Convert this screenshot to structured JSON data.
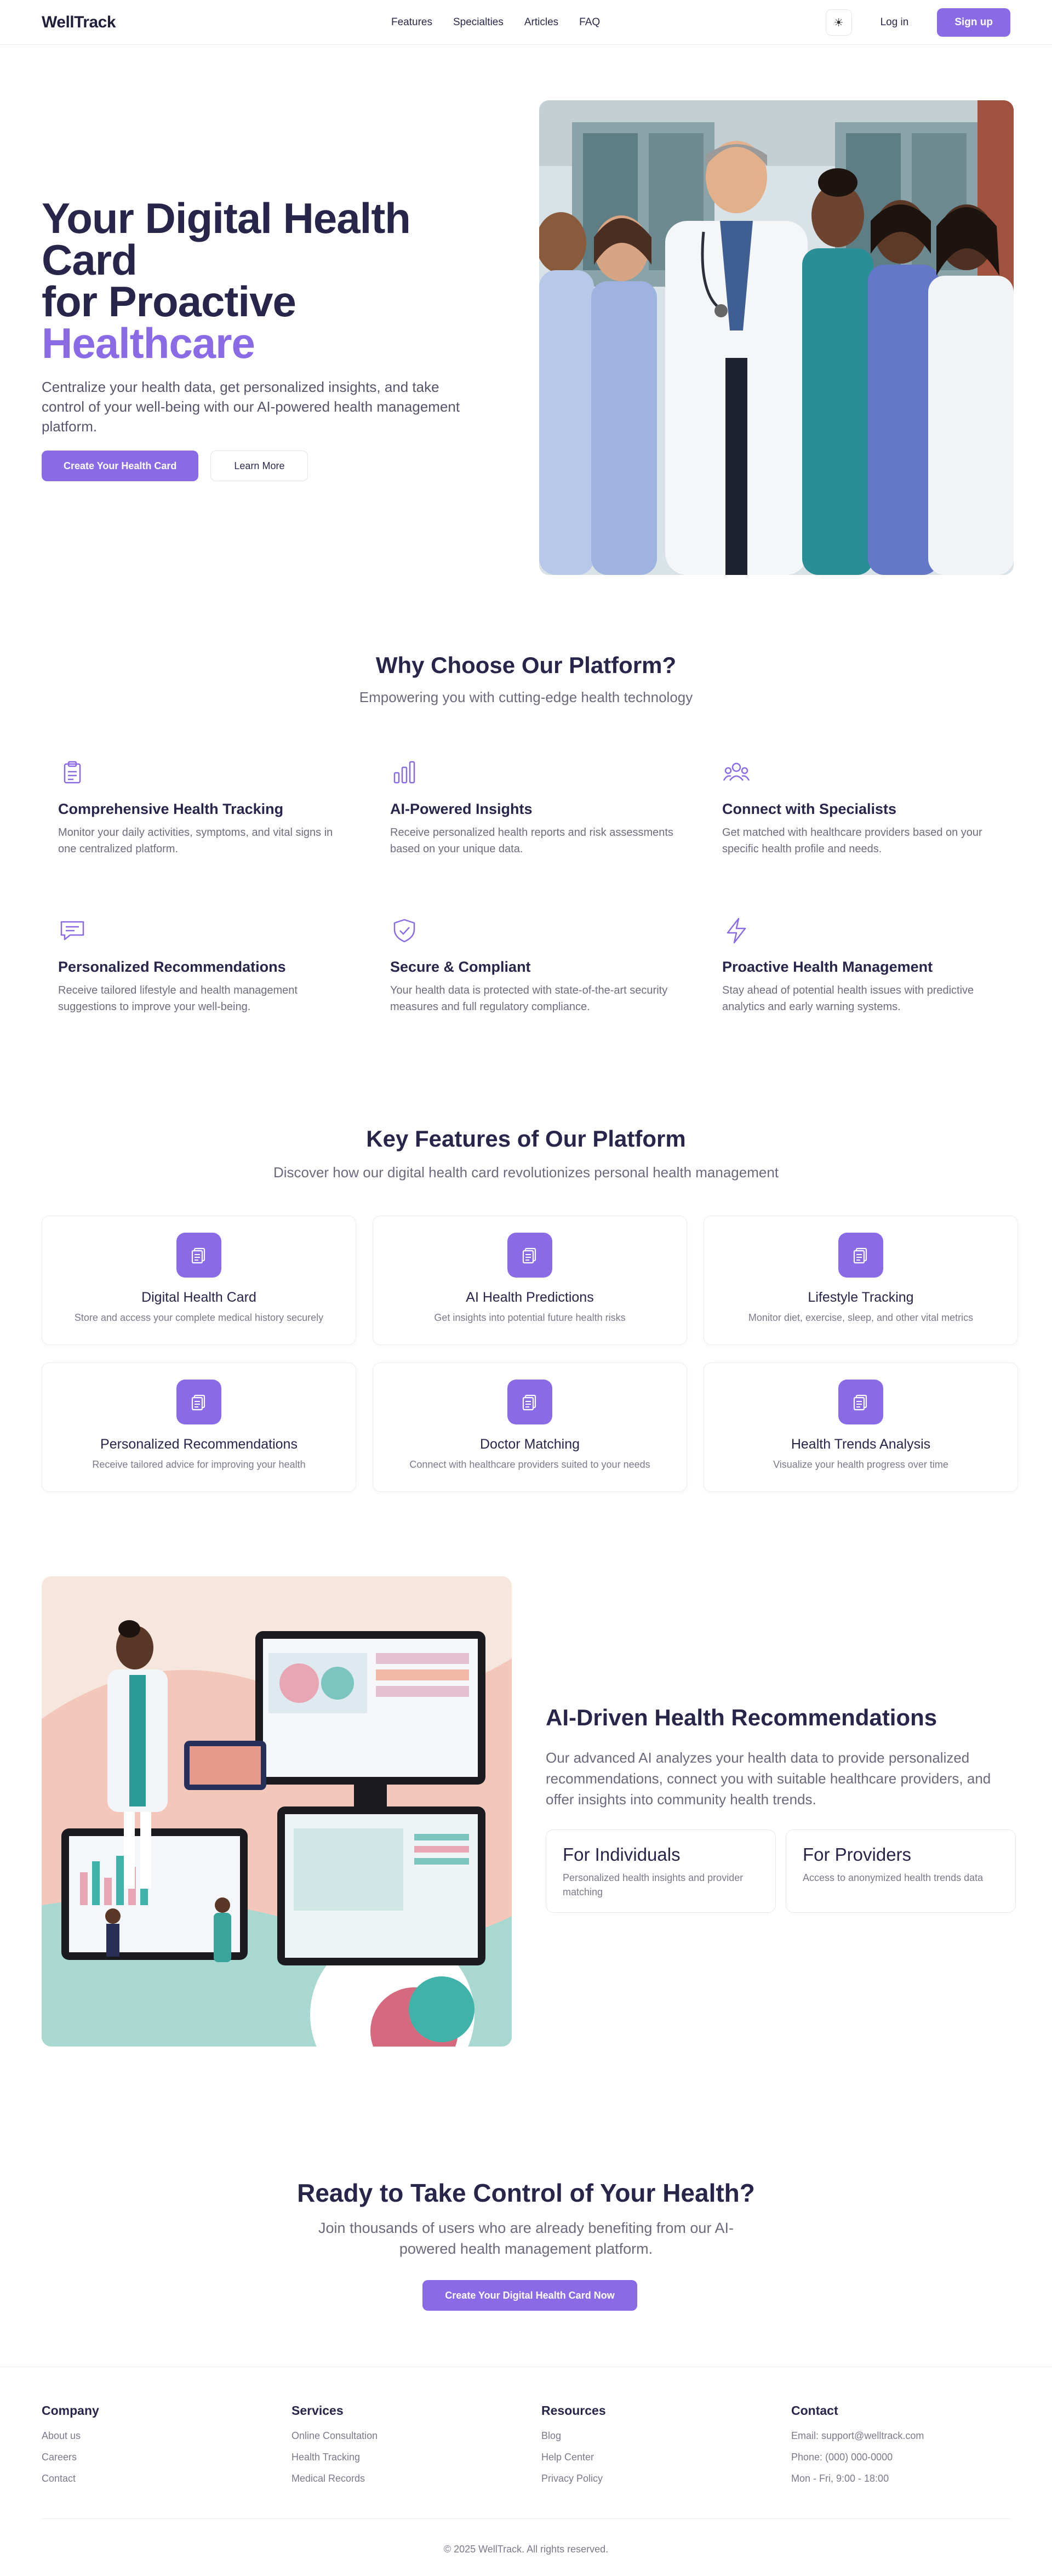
{
  "nav": {
    "logo": "WellTrack",
    "links": [
      "Features",
      "Specialties",
      "Articles",
      "FAQ"
    ],
    "theme_icon": "sun-icon",
    "theme_glyph": "☀",
    "login": "Log in",
    "signup": "Sign up"
  },
  "hero": {
    "title_line1": "Your Digital Health",
    "title_line2": "Card",
    "title_line3": "for Proactive",
    "title_accent": "Healthcare",
    "subtitle": "Centralize your health data, get personalized insights, and take control of your well-being with our AI-powered health management platform.",
    "primary_button": "Create Your Health Card",
    "secondary_button": "Learn More"
  },
  "why": {
    "title": "Why Choose Our Platform?",
    "subtitle": "Empowering you with cutting-edge health technology",
    "items": [
      {
        "icon": "clipboard-icon",
        "title": "Comprehensive Health Tracking",
        "desc": "Monitor your daily activities, symptoms, and vital signs in one centralized platform."
      },
      {
        "icon": "bar-chart-icon",
        "title": "AI-Powered Insights",
        "desc": "Receive personalized health reports and risk assessments based on your unique data."
      },
      {
        "icon": "users-icon",
        "title": "Connect with Specialists",
        "desc": "Get matched with healthcare providers based on your specific health profile and needs."
      },
      {
        "icon": "message-icon",
        "title": "Personalized Recommendations",
        "desc": "Receive tailored lifestyle and health management suggestions to improve your well-being."
      },
      {
        "icon": "shield-check-icon",
        "title": "Secure & Compliant",
        "desc": "Your health data is protected with state-of-the-art security measures and full regulatory compliance."
      },
      {
        "icon": "lightning-icon",
        "title": "Proactive Health Management",
        "desc": "Stay ahead of potential health issues with predictive analytics and early warning systems."
      }
    ]
  },
  "features": {
    "title": "Key Features of Our Platform",
    "subtitle": "Discover how our digital health card revolutionizes personal health management",
    "icon": "document-copy-icon",
    "cards": [
      {
        "title": "Digital Health Card",
        "desc": "Store and access your complete medical history securely"
      },
      {
        "title": "AI Health Predictions",
        "desc": "Get insights into potential future health risks"
      },
      {
        "title": "Lifestyle Tracking",
        "desc": "Monitor diet, exercise, sleep, and other vital metrics"
      },
      {
        "title": "Personalized Recommendations",
        "desc": "Receive tailored advice for improving your health"
      },
      {
        "title": "Doctor Matching",
        "desc": "Connect with healthcare providers suited to your needs"
      },
      {
        "title": "Health Trends Analysis",
        "desc": "Visualize your health progress over time"
      }
    ]
  },
  "ai": {
    "title": "AI-Driven Health Recommendations",
    "desc": "Our advanced AI analyzes your health data to provide personalized recommendations, connect you with suitable healthcare providers, and offer insights into community health trends.",
    "cards": [
      {
        "title": "For Individuals",
        "desc": "Personalized health insights and provider matching"
      },
      {
        "title": "For Providers",
        "desc": "Access to anonymized health trends data"
      }
    ]
  },
  "cta": {
    "title": "Ready to Take Control of Your Health?",
    "subtitle": "Join thousands of users who are already benefiting from our AI-powered health management platform.",
    "button": "Create Your Digital Health Card Now"
  },
  "footer": {
    "columns": [
      {
        "heading": "Company",
        "links": [
          "About us",
          "Careers",
          "Contact"
        ]
      },
      {
        "heading": "Services",
        "links": [
          "Online Consultation",
          "Health Tracking",
          "Medical Records"
        ]
      },
      {
        "heading": "Resources",
        "links": [
          "Blog",
          "Help Center",
          "Privacy Policy"
        ]
      },
      {
        "heading": "Contact",
        "links": [
          "Email: support@welltrack.com",
          "Phone: (000) 000-0000",
          "Mon - Fri, 9:00 - 18:00"
        ]
      }
    ],
    "copyright": "© 2025 WellTrack. All rights reserved."
  },
  "colors": {
    "accent": "#8b6ae6",
    "heading": "#27264a",
    "muted": "#6a6a7c"
  }
}
